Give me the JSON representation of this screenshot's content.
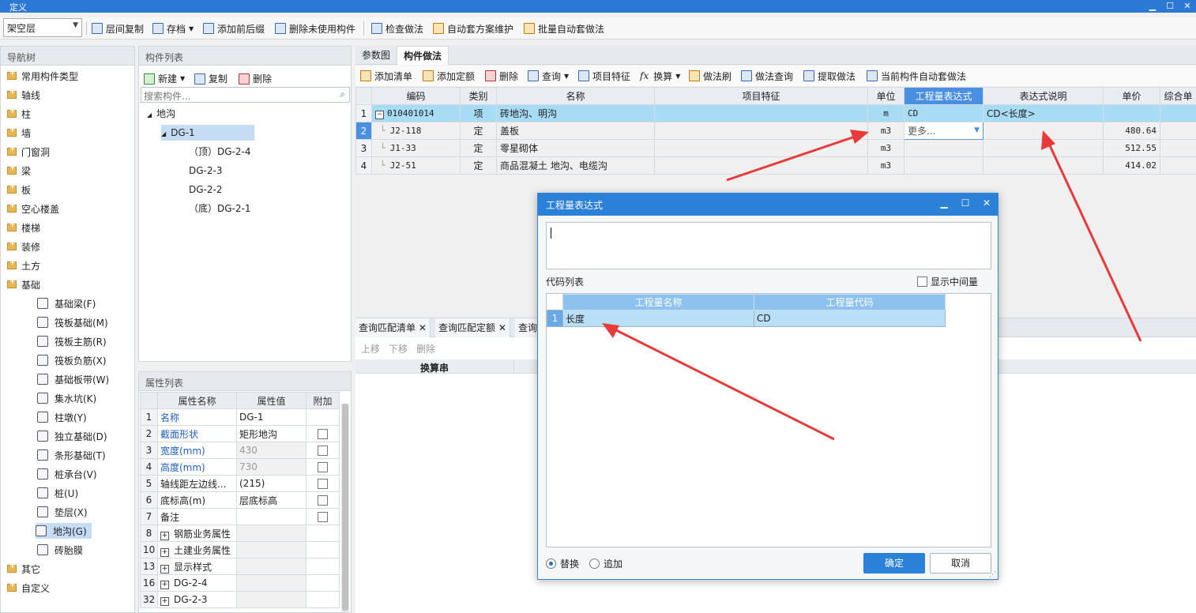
{
  "window": {
    "title": "定义",
    "controls": [
      "▫",
      "▫",
      "✕"
    ]
  },
  "toolbar": {
    "floor_select": "架空层",
    "buttons": [
      "层间复制",
      "存档",
      "添加前后缀",
      "删除未使用构件",
      "检查做法",
      "自动套方案维护",
      "批量自动套做法"
    ]
  },
  "nav": {
    "title": "导航树",
    "top_items": [
      "常用构件类型",
      "轴线",
      "柱",
      "墙",
      "门窗洞",
      "梁",
      "板",
      "空心楼盖",
      "楼梯",
      "装修",
      "土方",
      "基础"
    ],
    "sub_items": [
      "基础梁(F)",
      "筏板基础(M)",
      "筏板主筋(R)",
      "筏板负筋(X)",
      "基础板带(W)",
      "集水坑(K)",
      "柱墩(Y)",
      "独立基础(D)",
      "条形基础(T)",
      "桩承台(V)",
      "桩(U)",
      "垫层(X)",
      "地沟(G)",
      "砖胎膜"
    ],
    "selected_sub": "地沟(G)",
    "bottom_items": [
      "其它",
      "自定义"
    ]
  },
  "component_list": {
    "title": "构件列表",
    "actions": [
      "新建",
      "复制",
      "删除"
    ],
    "search_placeholder": "搜索构件...",
    "tree": {
      "root": "地沟",
      "child": "DG-1",
      "leaves": [
        "（顶）DG-2-4",
        "DG-2-3",
        "DG-2-2",
        "（底）DG-2-1"
      ]
    }
  },
  "properties": {
    "title": "属性列表",
    "headers": [
      "属性名称",
      "属性值",
      "附加"
    ],
    "rows": [
      {
        "num": "1",
        "name": "名称",
        "value": "DG-1",
        "blue": true,
        "gray": false,
        "check": false
      },
      {
        "num": "2",
        "name": "截面形状",
        "value": "矩形地沟",
        "blue": true,
        "gray": false,
        "check": true
      },
      {
        "num": "3",
        "name": "宽度(mm)",
        "value": "430",
        "blue": true,
        "gray": true,
        "check": true
      },
      {
        "num": "4",
        "name": "高度(mm)",
        "value": "730",
        "blue": true,
        "gray": true,
        "check": true
      },
      {
        "num": "5",
        "name": "轴线距左边线...",
        "value": "(215)",
        "blue": false,
        "gray": false,
        "check": true
      },
      {
        "num": "6",
        "name": "底标高(m)",
        "value": "层底标高",
        "blue": false,
        "gray": false,
        "check": true
      },
      {
        "num": "7",
        "name": "备注",
        "value": "",
        "blue": false,
        "gray": false,
        "check": true
      },
      {
        "num": "8",
        "name": "钢筋业务属性",
        "value": "",
        "blue": false,
        "gray": true,
        "check": false,
        "group": true
      },
      {
        "num": "10",
        "name": "土建业务属性",
        "value": "",
        "blue": false,
        "gray": true,
        "check": false,
        "group": true
      },
      {
        "num": "13",
        "name": "显示样式",
        "value": "",
        "blue": false,
        "gray": true,
        "check": false,
        "group": true
      },
      {
        "num": "16",
        "name": "DG-2-4",
        "value": "",
        "blue": false,
        "gray": true,
        "check": false,
        "group": true
      },
      {
        "num": "32",
        "name": "DG-2-3",
        "value": "",
        "blue": false,
        "gray": true,
        "check": false,
        "group": true
      }
    ]
  },
  "main": {
    "tabs": [
      "参数图",
      "构件做法"
    ],
    "active_tab": "构件做法",
    "actions": [
      "添加清单",
      "添加定额",
      "删除",
      "查询",
      "项目特征",
      "换算",
      "做法刷",
      "做法查询",
      "提取做法",
      "当前构件自动套做法"
    ],
    "headers": [
      "编码",
      "类别",
      "名称",
      "项目特征",
      "单位",
      "工程量表达式",
      "表达式说明",
      "单价",
      "综合单"
    ],
    "rows": [
      {
        "num": "1",
        "code": "010401014",
        "type": "项",
        "name": "砖地沟、明沟",
        "feature": "",
        "unit": "m",
        "expr": "CD",
        "desc": "CD<长度>",
        "price": "",
        "sel": true
      },
      {
        "num": "2",
        "code": "J2-118",
        "type": "定",
        "name": "盖板",
        "feature": "",
        "unit": "m3",
        "expr": "更多...",
        "desc": "",
        "price": "480.64",
        "sel": false
      },
      {
        "num": "3",
        "code": "J1-33",
        "type": "定",
        "name": "零星砌体",
        "feature": "",
        "unit": "m3",
        "expr": "",
        "desc": "",
        "price": "512.55",
        "sel": false
      },
      {
        "num": "4",
        "code": "J2-51",
        "type": "定",
        "name": "商品混凝土 地沟、电缆沟",
        "feature": "",
        "unit": "m3",
        "expr": "",
        "desc": "",
        "price": "414.02",
        "sel": false
      }
    ]
  },
  "lower": {
    "tabs": [
      "查询匹配清单",
      "查询匹配定额",
      "查询"
    ],
    "actions": [
      "上移",
      "下移",
      "删除"
    ],
    "header": "换算串"
  },
  "dialog": {
    "title": "工程量表达式",
    "expr_value": "",
    "code_list_label": "代码列表",
    "show_intermediate": "显示中间量",
    "headers": [
      "工程量名称",
      "工程量代码"
    ],
    "rows": [
      {
        "num": "1",
        "name": "长度",
        "code": "CD"
      }
    ],
    "radio_replace": "替换",
    "radio_append": "追加",
    "ok": "确定",
    "cancel": "取消"
  },
  "colors": {
    "accent": "#2b80d8",
    "selected_row": "#a8dcf4",
    "arrow": "#e83a3a"
  }
}
